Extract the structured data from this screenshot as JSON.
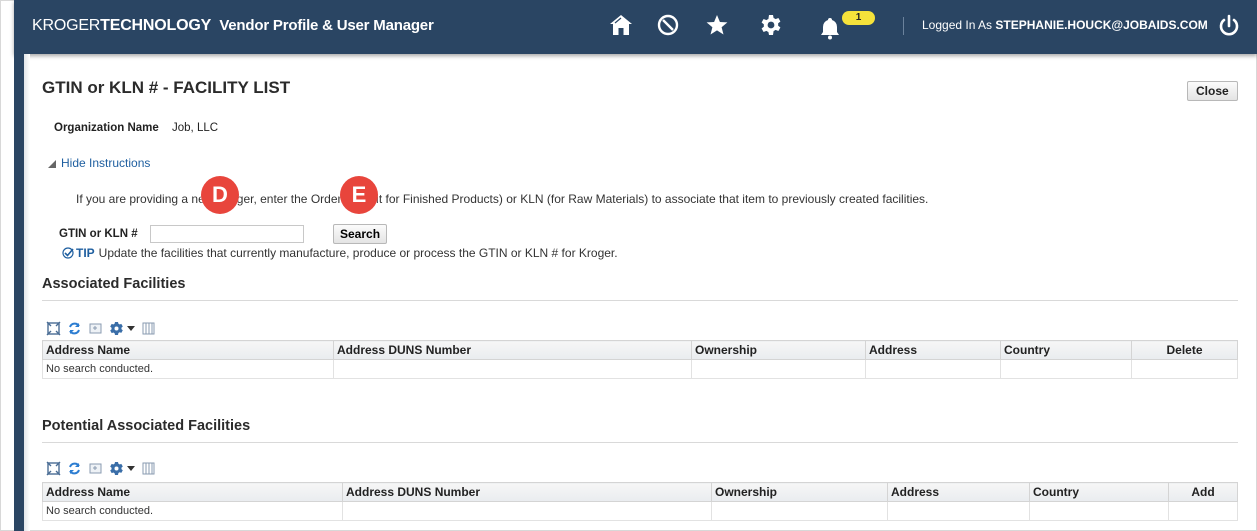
{
  "header": {
    "brand_kroger": "KROGER",
    "brand_tech": "TECHNOLOGY",
    "app_title": "Vendor Profile & User Manager",
    "notification_count": "1",
    "login_prefix": "Logged In As",
    "login_user": "STEPHANIE.HOUCK@JOBAIDS.COM",
    "icons": [
      "home-icon",
      "compass-icon",
      "star-icon",
      "gear-icon",
      "bell-icon",
      "power-icon"
    ],
    "bg_color": "#2a4563"
  },
  "page": {
    "title": "GTIN or KLN # - FACILITY LIST",
    "close_label": "Close",
    "org_label": "Organization Name",
    "org_value": "Job, LLC",
    "hide_instructions": "Hide Instructions",
    "instructions": "If you are providing a ne     o Kroger, enter the         Ordering Unit for Finished Products) or KLN (for Raw Materials) to associate that item to previously created facilities.",
    "gtin_label": "GTIN or KLN #",
    "gtin_value": "",
    "search_label": "Search",
    "tip_label": "TIP",
    "tip_text": "Update the facilities that currently manufacture, produce or process the GTIN or KLN # for Kroger."
  },
  "markers": {
    "d": "D",
    "e": "E",
    "color": "#e8453c"
  },
  "associated": {
    "title": "Associated Facilities",
    "columns": [
      "Address Name",
      "Address DUNS Number",
      "Ownership",
      "Address",
      "Country",
      "Delete"
    ],
    "empty_text": "No search conducted."
  },
  "potential": {
    "title": "Potential Associated Facilities",
    "columns": [
      "Address Name",
      "Address DUNS Number",
      "Ownership",
      "Address",
      "Country",
      "Add"
    ],
    "empty_text": "No search conducted."
  }
}
